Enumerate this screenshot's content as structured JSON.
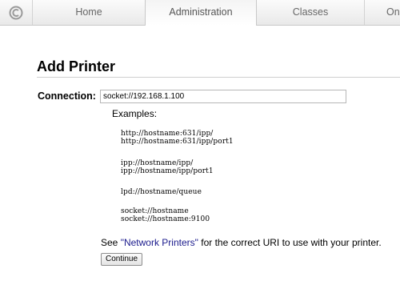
{
  "nav": {
    "logo_icon": "cups-logo-icon",
    "tabs": [
      {
        "label": "Home",
        "active": false
      },
      {
        "label": "Administration",
        "active": true
      },
      {
        "label": "Classes",
        "active": false
      },
      {
        "label": "On",
        "active": false
      }
    ]
  },
  "page": {
    "title": "Add Printer"
  },
  "form": {
    "connection_label": "Connection:",
    "connection_value": "socket://192.168.1.100",
    "examples_label": "Examples:",
    "example_groups": [
      [
        "http://hostname:631/ipp/",
        "http://hostname:631/ipp/port1"
      ],
      [
        "ipp://hostname/ipp/",
        "ipp://hostname/ipp/port1"
      ],
      [
        "lpd://hostname/queue"
      ],
      [
        "socket://hostname",
        "socket://hostname:9100"
      ]
    ],
    "hint_prefix": "See ",
    "hint_link": "\"Network Printers\"",
    "hint_suffix": " for the correct URI to use with your printer.",
    "continue_label": "Continue"
  },
  "colors": {
    "link": "#1a1a8c",
    "tab_text": "#666666"
  }
}
